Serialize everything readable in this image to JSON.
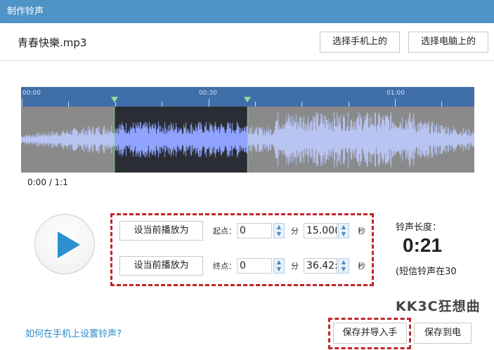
{
  "window": {
    "title": "制作铃声"
  },
  "file": {
    "name": "青春快樂.mp3"
  },
  "buttons": {
    "choose_phone": "选择手机上的",
    "choose_pc": "选择电脑上的",
    "set_start": "设当前播放为",
    "set_end": "设当前播放为",
    "save_import": "保存并导入手",
    "save_pc": "保存到电"
  },
  "timeline": {
    "labels": [
      "00:00",
      "00:30",
      "01:00"
    ],
    "selection_start_sec": 15.0,
    "selection_end_sec": 36.427
  },
  "playback": {
    "time": "0:00 / 1:1"
  },
  "start": {
    "label": "起点：",
    "minutes": "0",
    "min_unit": "分",
    "seconds": "15.00(",
    "sec_unit": "秒"
  },
  "end": {
    "label": "终点：",
    "minutes": "0",
    "min_unit": "分",
    "seconds": "36.42:",
    "sec_unit": "秒"
  },
  "ringtone": {
    "length_label": "铃声长度：",
    "length": "0:21",
    "note": "(短信铃声在30"
  },
  "watermark": "KK3C狂想曲",
  "help_link": "如何在手机上设置铃声?"
}
